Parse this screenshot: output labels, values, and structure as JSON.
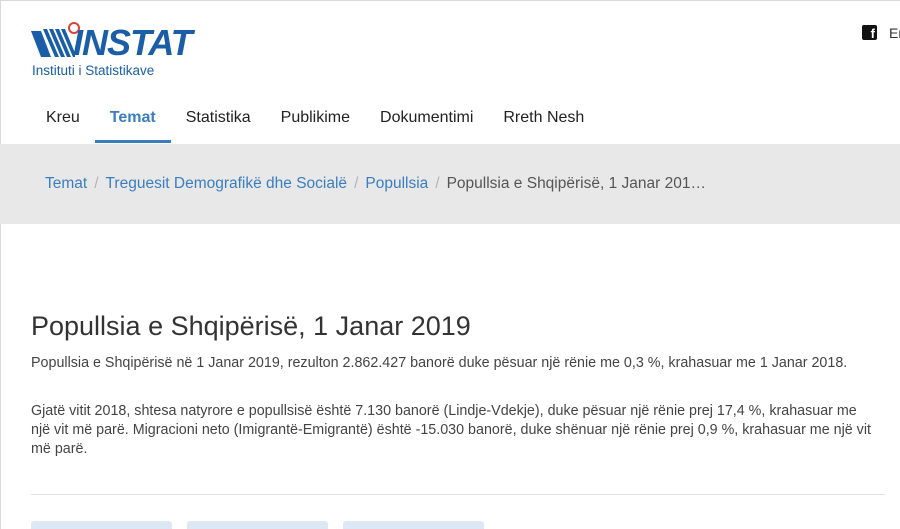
{
  "logo": {
    "wordmark": "INSTAT",
    "subtitle": "Instituti i Statistikave",
    "brand_color": "#1a5ea8",
    "dot_color": "#e0403a"
  },
  "header": {
    "facebook_icon": "facebook-icon",
    "language_link": "En"
  },
  "nav": {
    "items": [
      {
        "label": "Kreu",
        "active": false
      },
      {
        "label": "Temat",
        "active": true
      },
      {
        "label": "Statistika",
        "active": false
      },
      {
        "label": "Publikime",
        "active": false
      },
      {
        "label": "Dokumentimi",
        "active": false
      },
      {
        "label": "Rreth Nesh",
        "active": false
      }
    ],
    "accent_color": "#3a7ec0"
  },
  "breadcrumb": {
    "items": [
      "Temat",
      "Treguesit Demografikë dhe Socialë",
      "Popullsia"
    ],
    "current": "Popullsia e Shqipërisë, 1 Janar 201…",
    "separator": "/"
  },
  "article": {
    "title": "Popullsia e Shqipërisë, 1 Janar 2019",
    "paragraph1": "Popullsia e Shqipërisë në 1 Janar 2019, rezulton 2.862.427 banorë duke pësuar një rënie me 0,3 %, krahasuar me 1 Janar 2018.",
    "paragraph2": "Gjatë vitit 2018, shtesa natyrore e popullsisë është 7.130 banorë (Lindje-Vdekje), duke pësuar një rënie prej 17,4 %, krahasuar me një vit më parë. Migracioni neto (Imigrantë-Emigrantë) është -15.030 banorë, duke shënuar një rënie prej 0,9 %, krahasuar me një vit më parë."
  }
}
